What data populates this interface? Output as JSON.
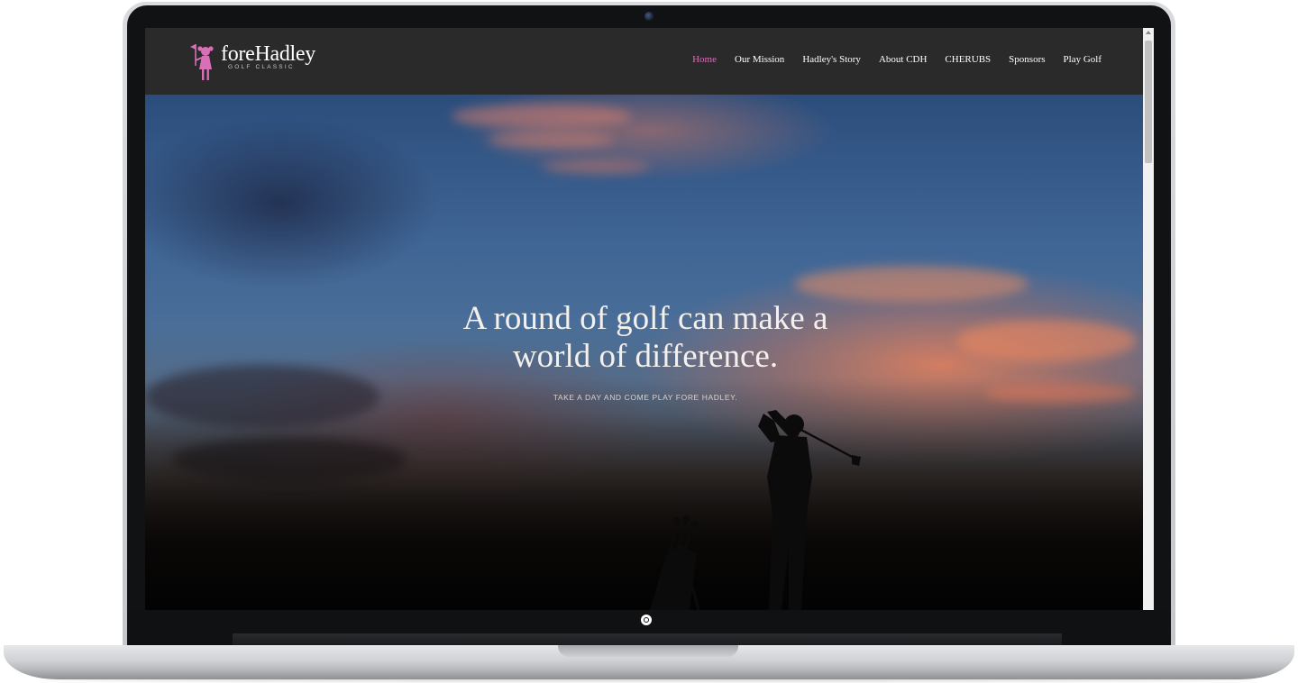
{
  "site": {
    "logo": {
      "wordmark_fore": "fore",
      "wordmark_name": "Hadley",
      "tagline": "GOLF CLASSIC",
      "accent_color": "#d86fb7"
    },
    "nav": {
      "items": [
        {
          "label": "Home",
          "active": true
        },
        {
          "label": "Our Mission",
          "active": false
        },
        {
          "label": "Hadley's Story",
          "active": false
        },
        {
          "label": "About CDH",
          "active": false
        },
        {
          "label": "CHERUBS",
          "active": false
        },
        {
          "label": "Sponsors",
          "active": false
        },
        {
          "label": "Play Golf",
          "active": false
        }
      ]
    },
    "hero": {
      "headline_line1": "A round of golf can make a",
      "headline_line2": "world of difference.",
      "subheading": "TAKE A DAY AND COME PLAY   FORE HADLEY."
    }
  },
  "device": {
    "type": "laptop-mockup",
    "icons": [
      "camera-icon",
      "power-icon"
    ]
  }
}
